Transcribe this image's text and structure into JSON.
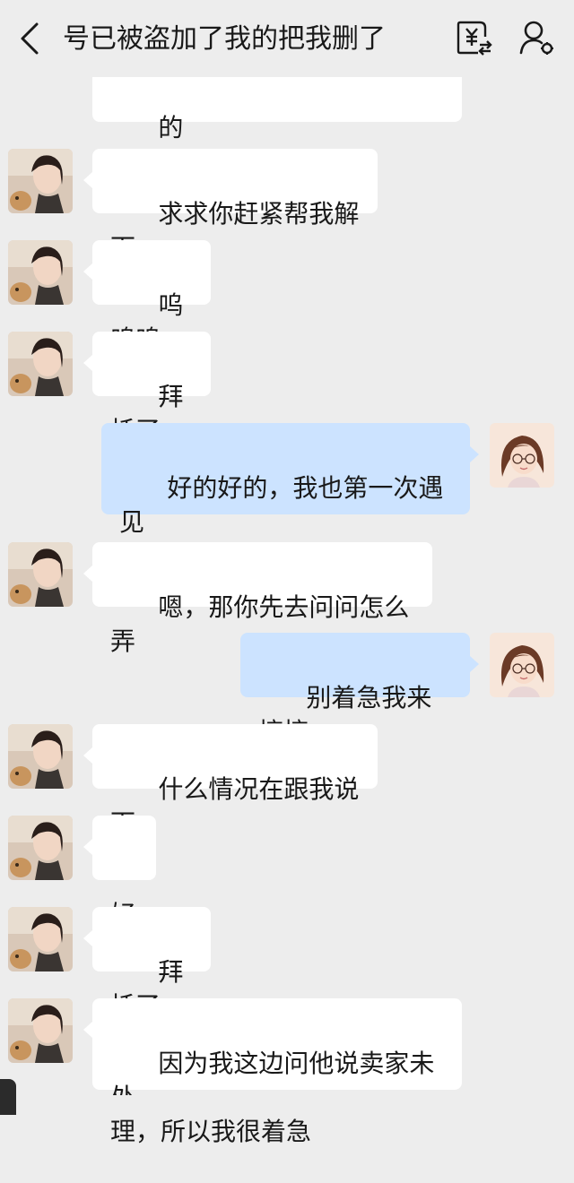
{
  "header": {
    "title": "号已被盗加了我的把我删了",
    "back_icon": "chevron-left-icon",
    "transfer_icon": "yuan-transfer-icon",
    "profile_icon": "contact-profile-icon"
  },
  "messages": [
    {
      "side": "in",
      "text": "的"
    },
    {
      "side": "in",
      "text": "求求你赶紧帮我解下"
    },
    {
      "side": "in",
      "text": "呜呜呜"
    },
    {
      "side": "in",
      "text": "拜托了"
    },
    {
      "side": "out",
      "text": "好的好的，我也第一次遇见\n这种情况，"
    },
    {
      "side": "in",
      "text": "嗯，那你先去问问怎么弄"
    },
    {
      "side": "out",
      "text": "别着急我来搞搞"
    },
    {
      "side": "in",
      "text": "什么情况在跟我说下"
    },
    {
      "side": "in",
      "text": "好"
    },
    {
      "side": "in",
      "text": "拜托了"
    },
    {
      "side": "in",
      "text": "因为我这边问他说卖家未处\n理，所以我很着急"
    }
  ],
  "colors": {
    "background": "#ededed",
    "incoming_bubble": "#ffffff",
    "outgoing_bubble": "#cce3ff"
  }
}
